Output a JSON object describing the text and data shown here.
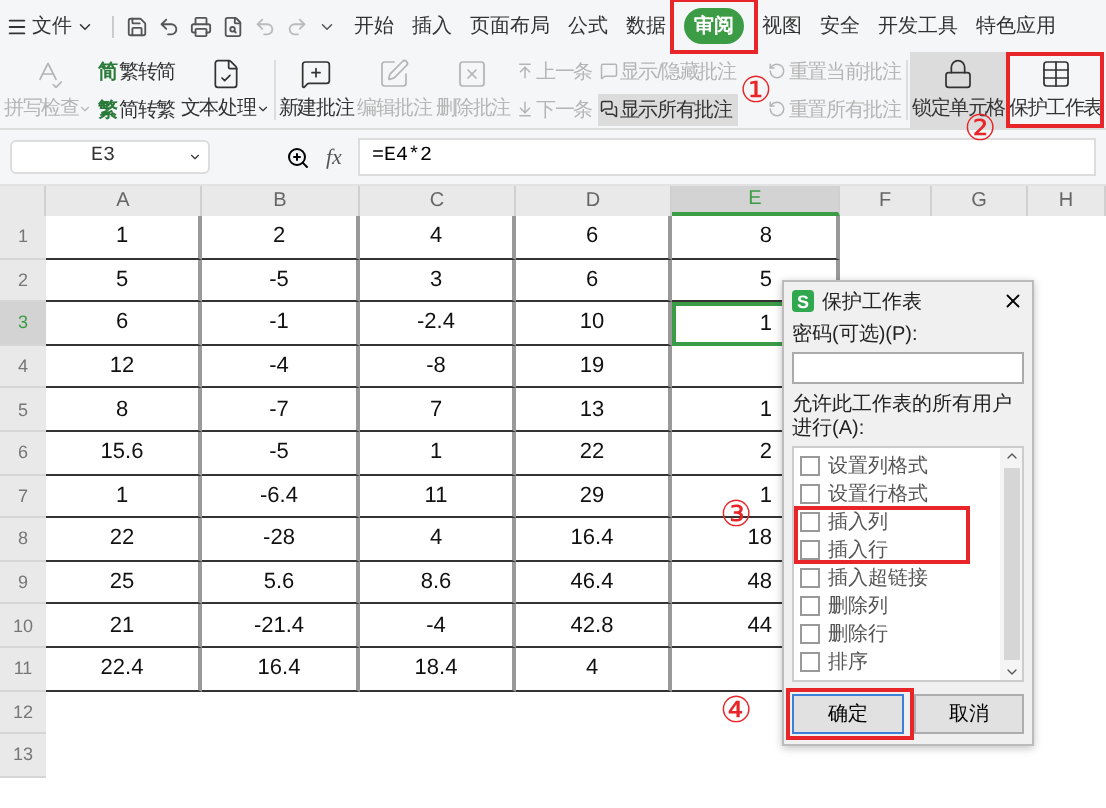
{
  "menu": {
    "label": "文件"
  },
  "tabs": [
    {
      "label": "开始",
      "selected": false
    },
    {
      "label": "插入",
      "selected": false
    },
    {
      "label": "页面布局",
      "selected": false
    },
    {
      "label": "公式",
      "selected": false
    },
    {
      "label": "数据",
      "selected": false
    },
    {
      "label": "审阅",
      "selected": true
    },
    {
      "label": "视图",
      "selected": false
    },
    {
      "label": "安全",
      "selected": false
    },
    {
      "label": "开发工具",
      "selected": false
    },
    {
      "label": "特色应用",
      "selected": false
    }
  ],
  "ribbon": [
    {
      "kind": "large",
      "label": "拼写检查",
      "disabled": true,
      "pressed": false,
      "dropdown": true
    },
    {
      "kind": "stack",
      "items": [
        {
          "glyph": "简",
          "label": "繁转简",
          "disabled": false,
          "pressed": false
        },
        {
          "glyph": "繁",
          "label": "简转繁",
          "disabled": false,
          "pressed": false
        }
      ]
    },
    {
      "kind": "large",
      "label": "文本处理",
      "disabled": false,
      "pressed": false,
      "dropdown": true
    },
    {
      "kind": "large",
      "label": "新建批注",
      "disabled": false,
      "pressed": false,
      "dropdown": false
    },
    {
      "kind": "large",
      "label": "编辑批注",
      "disabled": true,
      "pressed": false,
      "dropdown": false
    },
    {
      "kind": "large",
      "label": "删除批注",
      "disabled": true,
      "pressed": false,
      "dropdown": false
    },
    {
      "kind": "stack",
      "items": [
        {
          "label": "上一条",
          "disabled": true,
          "pressed": false
        },
        {
          "label": "下一条",
          "disabled": true,
          "pressed": false
        }
      ]
    },
    {
      "kind": "stack",
      "items": [
        {
          "label": "显示/隐藏批注",
          "disabled": true,
          "pressed": false
        },
        {
          "label": "显示所有批注",
          "disabled": false,
          "pressed": true
        }
      ]
    },
    {
      "kind": "stack",
      "items": [
        {
          "label": "重置当前批注",
          "disabled": true,
          "pressed": false
        },
        {
          "label": "重置所有批注",
          "disabled": true,
          "pressed": false
        }
      ]
    },
    {
      "kind": "large",
      "label": "锁定单元格",
      "disabled": false,
      "pressed": true,
      "dropdown": false
    },
    {
      "kind": "large",
      "label": "保护工作表",
      "disabled": false,
      "pressed": false,
      "dropdown": false
    }
  ],
  "name_box": "E3",
  "fx": "fx",
  "formula": "=E4*2",
  "columns": [
    {
      "label": "A",
      "selected": false
    },
    {
      "label": "B",
      "selected": false
    },
    {
      "label": "C",
      "selected": false
    },
    {
      "label": "D",
      "selected": false
    },
    {
      "label": "E",
      "selected": true
    },
    {
      "label": "F",
      "selected": false
    },
    {
      "label": "G",
      "selected": false
    },
    {
      "label": "H",
      "selected": false
    }
  ],
  "rows": [
    {
      "number": "1",
      "selected": false,
      "cells": [
        "1",
        "2",
        "4",
        "6",
        "8"
      ]
    },
    {
      "number": "2",
      "selected": false,
      "cells": [
        "5",
        "-5",
        "3",
        "6",
        "5"
      ]
    },
    {
      "number": "3",
      "selected": true,
      "cells": [
        "6",
        "-1",
        "-2.4",
        "10",
        "1"
      ]
    },
    {
      "number": "4",
      "selected": false,
      "cells": [
        "12",
        "-4",
        "-8",
        "19"
      ]
    },
    {
      "number": "5",
      "selected": false,
      "cells": [
        "8",
        "-7",
        "7",
        "13",
        "1"
      ]
    },
    {
      "number": "6",
      "selected": false,
      "cells": [
        "15.6",
        "-5",
        "1",
        "22",
        "2"
      ]
    },
    {
      "number": "7",
      "selected": false,
      "cells": [
        "1",
        "-6.4",
        "11",
        "29",
        "1"
      ]
    },
    {
      "number": "8",
      "selected": false,
      "cells": [
        "22",
        "-28",
        "4",
        "16.4",
        "18"
      ]
    },
    {
      "number": "9",
      "selected": false,
      "cells": [
        "25",
        "5.6",
        "8.6",
        "46.4",
        "48"
      ]
    },
    {
      "number": "10",
      "selected": false,
      "cells": [
        "21",
        "-21.4",
        "-4",
        "42.8",
        "44"
      ]
    },
    {
      "number": "11",
      "selected": false,
      "cells": [
        "22.4",
        "16.4",
        "18.4",
        "4"
      ]
    },
    {
      "number": "12",
      "selected": false,
      "cells": []
    },
    {
      "number": "13",
      "selected": false,
      "cells": []
    }
  ],
  "dialog": {
    "app_glyph": "S",
    "title": "保护工作表",
    "password_label": "密码(可选)(P):",
    "permissions_label": "允许此工作表的所有用户进行(A):",
    "permissions": [
      {
        "label": "设置列格式",
        "checked": false
      },
      {
        "label": "设置行格式",
        "checked": false
      },
      {
        "label": "插入列",
        "checked": false
      },
      {
        "label": "插入行",
        "checked": false
      },
      {
        "label": "插入超链接",
        "checked": false
      },
      {
        "label": "删除列",
        "checked": false
      },
      {
        "label": "删除行",
        "checked": false
      },
      {
        "label": "排序",
        "checked": false
      }
    ],
    "buttons": [
      {
        "label": "确定",
        "default": true
      },
      {
        "label": "取消",
        "default": false
      }
    ]
  },
  "annotations": [
    {
      "label": "①"
    },
    {
      "label": "②"
    },
    {
      "label": "③"
    },
    {
      "label": "④"
    }
  ]
}
